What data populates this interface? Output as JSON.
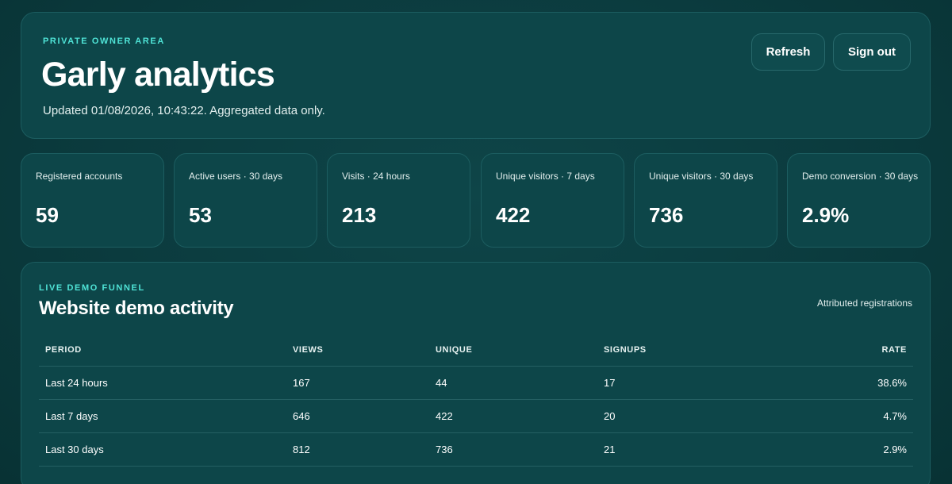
{
  "header": {
    "eyebrow": "PRIVATE OWNER AREA",
    "title": "Garly analytics",
    "updated": "Updated 01/08/2026, 10:43:22. Aggregated data only.",
    "refresh_label": "Refresh",
    "signout_label": "Sign out"
  },
  "stats": [
    {
      "label": "Registered accounts",
      "value": "59"
    },
    {
      "label": "Active users · 30 days",
      "value": "53"
    },
    {
      "label": "Visits · 24 hours",
      "value": "213"
    },
    {
      "label": "Unique visitors · 7 days",
      "value": "422"
    },
    {
      "label": "Unique visitors · 30 days",
      "value": "736"
    },
    {
      "label": "Demo conversion · 30 days",
      "value": "2.9%"
    }
  ],
  "funnel": {
    "eyebrow": "LIVE DEMO FUNNEL",
    "title": "Website demo activity",
    "attributed": "Attributed registrations",
    "columns": [
      "PERIOD",
      "VIEWS",
      "UNIQUE",
      "SIGNUPS",
      "RATE"
    ],
    "rows": [
      [
        "Last 24 hours",
        "167",
        "44",
        "17",
        "38.6%"
      ],
      [
        "Last 7 days",
        "646",
        "422",
        "20",
        "4.7%"
      ],
      [
        "Last 30 days",
        "812",
        "736",
        "21",
        "2.9%"
      ]
    ]
  },
  "colors": {
    "background": "#0b3a3d",
    "card": "#0d4649",
    "accent": "#4fe3d6",
    "border": "#1c5d60"
  }
}
